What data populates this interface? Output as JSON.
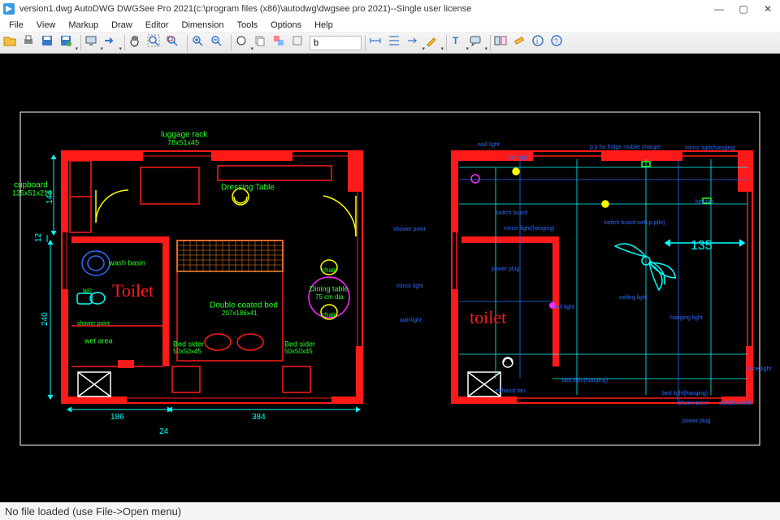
{
  "window": {
    "title": "version1.dwg AutoDWG DWGSee Pro 2021(c:\\program files (x86)\\autodwg\\dwgsee pro 2021)--Single user license",
    "min": "—",
    "max": "▢",
    "close": "✕"
  },
  "menu": [
    "File",
    "View",
    "Markup",
    "Draw",
    "Editor",
    "Dimension",
    "Tools",
    "Options",
    "Help"
  ],
  "toolbar": {
    "textbox_value": "b"
  },
  "status": "No file loaded (use File->Open menu)",
  "drawing": {
    "left_plan": {
      "cupboard": "cupboard",
      "cupboard_dim": "125x51x210",
      "luggage": "luggage rack",
      "luggage_dim": "78x51x45",
      "dressing": "Dressing Table",
      "wash": "wash basin",
      "wc": "w/c",
      "toilet": "Toilet",
      "shower": "shower point",
      "wet": "wet area",
      "bed": "Double coated bed",
      "bed_dim": "207x186x41",
      "bedsider1": "Bed sider",
      "bedsider1_dim": "50x50x45",
      "bedsider2": "Bed sider",
      "bedsider2_dim": "50x50x45",
      "chair1": "chair",
      "chair2": "chair",
      "dining": "Dining table",
      "dining_dim": "75 cm dia",
      "dim_144": "144",
      "dim_12": "12",
      "dim_240": "240",
      "dim_186": "186",
      "dim_384": "384",
      "dim_24": "24"
    },
    "right_plan": {
      "toilet": "toilet",
      "dim_135": "135",
      "wall_light": "wall light",
      "bed_light": "bed light",
      "switch_board": "switch board",
      "mirror_light": "mirror light(hanging)",
      "pp_fridge": "p.p for fridge mobile charger",
      "mirror_light2": "mirror light(hanging)",
      "key_tag": "key tag",
      "switch_board2": "switch board with p.p(tv)",
      "shower_pt": "shower point",
      "power_plug": "power plug",
      "mirror_light3": "mirror light",
      "wall_light2": "wall light",
      "wall_light3": "wall light",
      "ceiling_light": "ceiling light",
      "hanging_light": "hanging light",
      "exhaust": "exhaust fan",
      "bed_hang": "bed light(hanging)",
      "bed_hang2": "bed light(hanging)",
      "tube": "tube light",
      "phone": "phone point",
      "switch3": "switch board",
      "power_plug2": "power plug"
    }
  }
}
